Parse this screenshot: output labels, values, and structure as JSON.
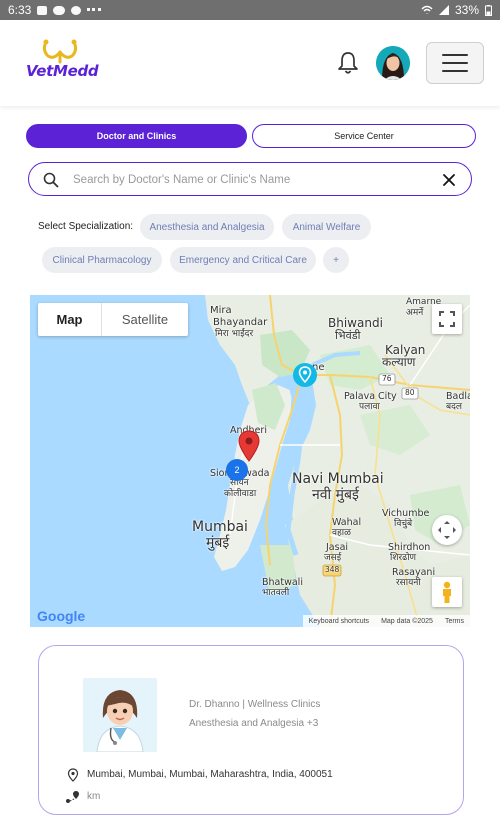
{
  "status_bar": {
    "time": "6:33",
    "battery": "33%"
  },
  "app": {
    "logo_text": "VetMedd",
    "brand_color": "#5b22d6"
  },
  "header": {
    "bell_icon": "bell-icon",
    "menu_icon": "hamburger-menu-icon"
  },
  "tabs": [
    {
      "label": "Doctor and Clinics",
      "active": true
    },
    {
      "label": "Service Center",
      "active": false
    }
  ],
  "search": {
    "placeholder": "Search by Doctor's Name or Clinic's Name",
    "value": ""
  },
  "specialization": {
    "label": "Select Specialization:",
    "chips": [
      "Anesthesia and Analgesia",
      "Animal Welfare",
      "Clinical Pharmacology",
      "Emergency and Critical Care",
      "+"
    ]
  },
  "map": {
    "type_map": "Map",
    "type_satellite": "Satellite",
    "labels": {
      "mira": "Mira",
      "bhayandar": "Bhayandar",
      "mira_mr": "मिरा भाईंदर",
      "bhiwandi": "Bhiwandi",
      "bhiwandi_mr": "भिवंडी",
      "amarne": "Amarne",
      "amarne_mr": "अमर्ने",
      "kalyan": "Kalyan",
      "kalyan_mr": "कल्याण",
      "palava": "Palava City",
      "palava_mr": "पलावा",
      "thane": "ne",
      "badla": "Badla",
      "badla_mr": "बदल",
      "andheri": "Andheri",
      "sion": "Sion",
      "wada": "wada",
      "sion_mr": "सायन",
      "koliwada_mr": "कोलीवाडा",
      "navi": "Navi Mumbai",
      "navi_mr": "नवी मुंबई",
      "mumbai": "Mumbai",
      "mumbai_mr": "मुंबई",
      "wahal": "Wahal",
      "wahal_mr": "वहाळ",
      "jasai": "Jasai",
      "jasai_mr": "जसई",
      "vichumbe": "Vichumbe",
      "vichumbe_mr": "विचुंबे",
      "shirdhon": "Shirdhon",
      "shirdhon_mr": "शिरढोण",
      "bhatwali": "Bhatwali",
      "bhatwali_mr": "भातवली",
      "rasayani": "Rasayani",
      "rasayani_mr": "रसायनी",
      "r76": "76",
      "r80": "80",
      "r348": "348"
    },
    "cluster_count": "2",
    "google": "Google",
    "keyboard": "Keyboard shortcuts",
    "map_data": "Map data ©2025",
    "terms": "Terms"
  },
  "card": {
    "doctor_line": "Dr. Dhanno  | Wellness Clinics",
    "specialization_line": "Anesthesia and Analgesia +3",
    "address": "Mumbai, Mumbai, Mumbai, Maharashtra, India, 400051",
    "distance": "km"
  }
}
